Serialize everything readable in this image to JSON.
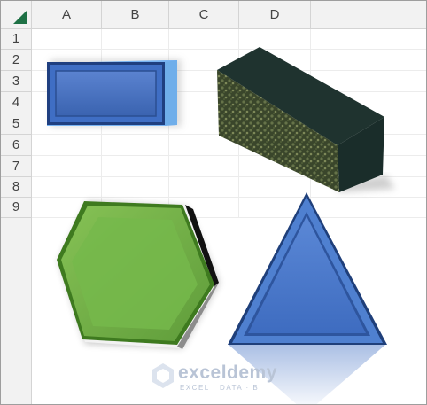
{
  "sheet": {
    "columns": [
      "A",
      "B",
      "C",
      "D"
    ],
    "rows": [
      "1",
      "2",
      "3",
      "4",
      "5",
      "6",
      "7",
      "8",
      "9"
    ]
  },
  "shapes": [
    {
      "name": "bevel-rectangle",
      "color": "#4472c4"
    },
    {
      "name": "textured-box",
      "color": "#1f3a34"
    },
    {
      "name": "hexagon",
      "color": "#70ad47"
    },
    {
      "name": "triangle",
      "color": "#4472c4"
    }
  ],
  "watermark": {
    "name": "exceldemy",
    "tagline": "EXCEL · DATA · BI"
  }
}
